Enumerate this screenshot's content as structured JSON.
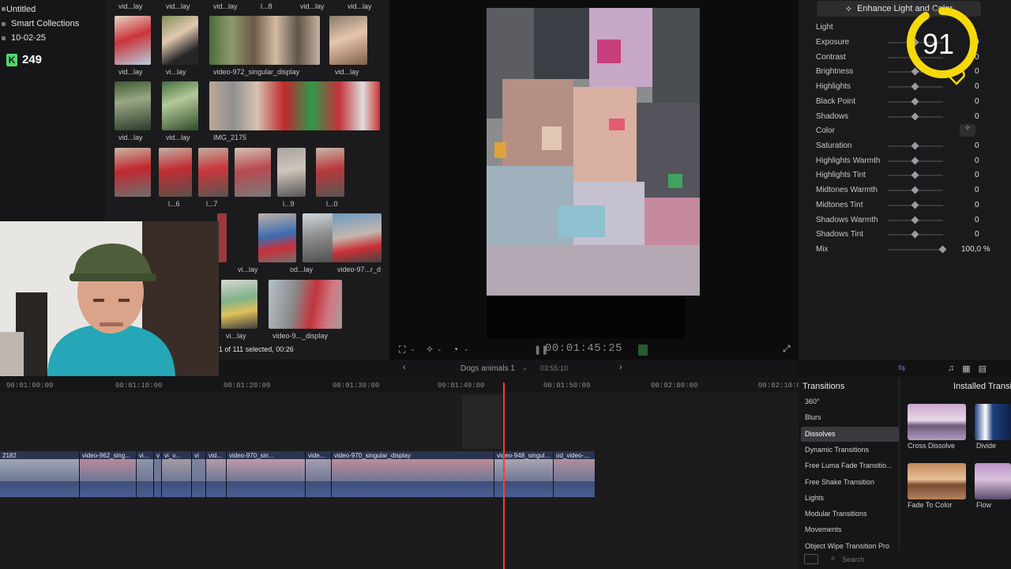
{
  "library": {
    "items": [
      "Untitled",
      "Smart Collections",
      "10-02-25"
    ],
    "badge_value": "249"
  },
  "browser": {
    "captions": [
      "vid...lay",
      "vid...lay",
      "vid...lay",
      "l...8",
      "vid...lay",
      "vid...lay",
      "vid...lay",
      "vi...lay",
      "video-972_singular_display",
      "vid...lay",
      "vid...lay",
      "vid...lay",
      "IMG_2175",
      "l...6",
      "l...7",
      "l...9",
      "l...0",
      "vi...lay",
      "od...lay",
      "video-97...r_d",
      "vi...lay",
      "video-9..._display"
    ],
    "status": "1 of 111 selected, 00:26"
  },
  "viewer": {
    "timecode": "00:01:45:25",
    "fullscreen_icon": "fullscreen-icon"
  },
  "inspector": {
    "enhance_label": "Enhance Light and Color",
    "light_label": "Light",
    "color_label": "Color",
    "light_params": [
      {
        "label": "Exposure",
        "value": "0",
        "level": 0.5
      },
      {
        "label": "Contrast",
        "value": "0",
        "level": 0.5
      },
      {
        "label": "Brightness",
        "value": "0",
        "level": 0.5
      },
      {
        "label": "Highlights",
        "value": "0",
        "level": 0.5
      },
      {
        "label": "Black Point",
        "value": "0",
        "level": 0.5
      },
      {
        "label": "Shadows",
        "value": "0",
        "level": 0.5
      }
    ],
    "color_params": [
      {
        "label": "Saturation",
        "value": "0",
        "level": 0.5
      },
      {
        "label": "Highlights Warmth",
        "value": "0",
        "level": 0.5
      },
      {
        "label": "Highlights Tint",
        "value": "0",
        "level": 0.5
      },
      {
        "label": "Midtones Warmth",
        "value": "0",
        "level": 0.5
      },
      {
        "label": "Midtones Tint",
        "value": "0",
        "level": 0.5
      },
      {
        "label": "Shadows Warmth",
        "value": "0",
        "level": 0.5
      },
      {
        "label": "Shadows Tint",
        "value": "0",
        "level": 0.5
      }
    ],
    "mix": {
      "label": "Mix",
      "value": "100,0 %",
      "level": 1.0
    }
  },
  "score_overlay": {
    "value": "91",
    "level": 0.91
  },
  "timeline": {
    "project_name": "Dogs animals 1",
    "project_duration": "03:55:10",
    "ruler": [
      "00:01:00:00",
      "00:01:10:00",
      "00:01:20:00",
      "00:01:30:00",
      "00:01:40:00",
      "00:01:50:00",
      "00:02:00:00",
      "00:02:10:00"
    ],
    "clips": [
      {
        "title": "2182"
      },
      {
        "title": "video-962_sing..."
      },
      {
        "title": "vi..."
      },
      {
        "title": "v"
      },
      {
        "title": "vi_v..."
      },
      {
        "title": "vi"
      },
      {
        "title": "vid..."
      },
      {
        "title": "video-970_sin..."
      },
      {
        "title": "vide..."
      },
      {
        "title": "video-970_singular_display"
      },
      {
        "title": "video-948_singul..."
      },
      {
        "title": "od_video-..."
      }
    ]
  },
  "transitions": {
    "title": "Transitions",
    "installed_label": "Installed Transitions",
    "categories": [
      "360°",
      "Blurs",
      "Dissolves",
      "Dynamic Transitions",
      "Free Luma Fade Transitio...",
      "Free Shake Transition",
      "Lights",
      "Modular Transitions",
      "Movements",
      "Object Wipe Transition Pro"
    ],
    "selected_category": "Dissolves",
    "items": [
      "Cross Dissolve",
      "Divide",
      "Fade To Color",
      "Flow"
    ],
    "search_placeholder": "Search"
  },
  "colors": {
    "accent_yellow": "#f5d90a",
    "playhead_red": "#ff3b30",
    "storyline_blue": "#2a3350",
    "badge_green": "#53d66b"
  }
}
